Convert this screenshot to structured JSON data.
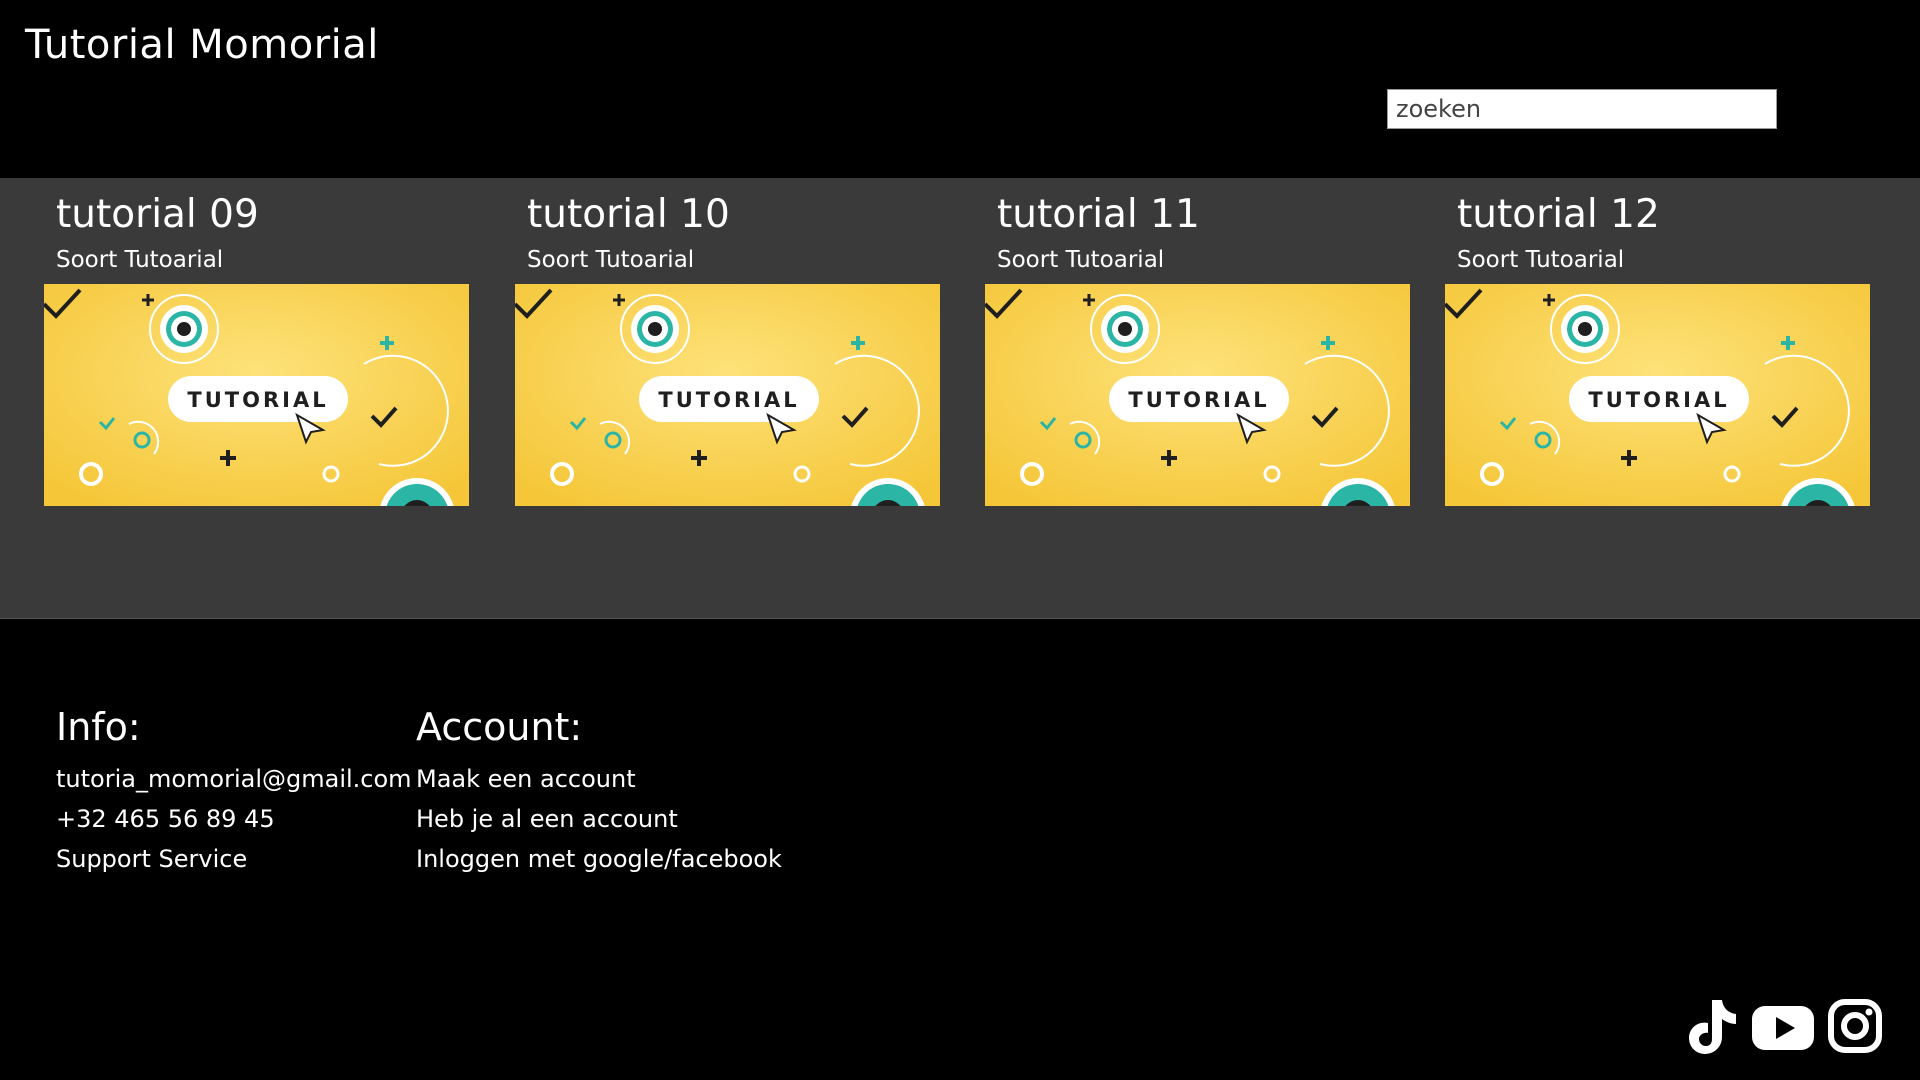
{
  "header": {
    "title": "Tutorial Momorial",
    "search": {
      "placeholder": "zoeken",
      "value": ""
    }
  },
  "tutorials": [
    {
      "title": "tutorial 09",
      "subtitle": "Soort Tutoarial",
      "thumbnail_text": "TUTORIAL"
    },
    {
      "title": "tutorial 10",
      "subtitle": "Soort Tutoarial",
      "thumbnail_text": "TUTORIAL"
    },
    {
      "title": "tutorial 11",
      "subtitle": "Soort Tutoarial",
      "thumbnail_text": "TUTORIAL"
    },
    {
      "title": "tutorial 12",
      "subtitle": "Soort Tutoarial",
      "thumbnail_text": "TUTORIAL"
    }
  ],
  "footer": {
    "info": {
      "title": "Info:",
      "email": "tutoria_momorial@gmail.com",
      "phone": "+32 465 56 89 45",
      "support": "Support Service"
    },
    "account": {
      "title": "Account:",
      "create": "Maak een account",
      "existing": "Heb je al een account",
      "social_login": "Inloggen met google/facebook"
    },
    "social_icons": [
      "tiktok-icon",
      "youtube-icon",
      "instagram-icon"
    ]
  },
  "colors": {
    "background": "#000000",
    "content_band": "#3a3a3a",
    "thumbnail_yellow": "#f7cd3f",
    "thumbnail_teal": "#2bb5a5"
  }
}
